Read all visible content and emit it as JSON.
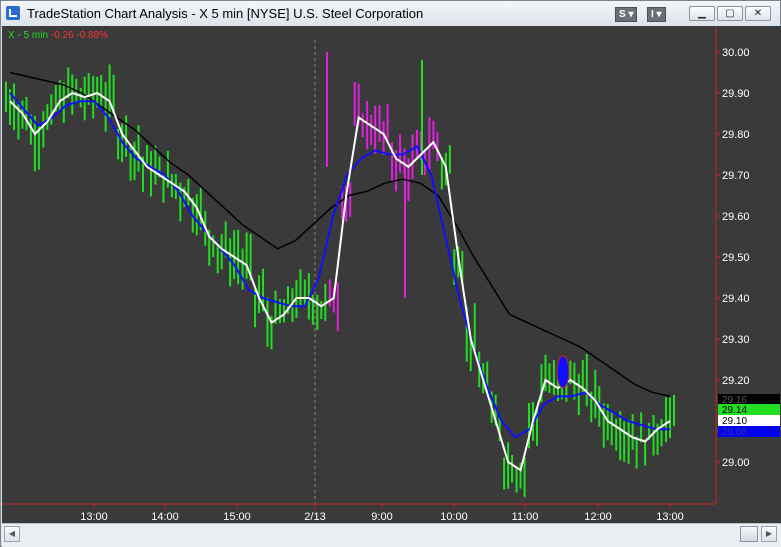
{
  "window": {
    "title": "TradeStation Chart Analysis - X 5 min [NYSE] U.S. Steel Corporation",
    "btn_s": "S ▾",
    "btn_i": "I ▾"
  },
  "chart_header": {
    "symbol": "X - 5 min",
    "change": "-0.26",
    "pct": "-0.88%"
  },
  "colors": {
    "background": "#3a3a3a",
    "up_bar": "#22dd22",
    "down_bar": "#22dd22",
    "highlight_bar": "#dd22dd",
    "fast_avg": "#ffffff",
    "mid_avg": "#1010ff",
    "slow_avg": "#000000",
    "axis": "#cc2222"
  },
  "price_labels": [
    {
      "text": "29.16",
      "bg": "#000000",
      "fg": "#555555"
    },
    {
      "text": "29.14",
      "bg": "#22dd22",
      "fg": "#000000"
    },
    {
      "text": "29.10",
      "bg": "#ffffff",
      "fg": "#000000"
    },
    {
      "text": "29.08",
      "bg": "#0000ee",
      "fg": "#3333aa"
    }
  ],
  "chart_data": {
    "type": "line",
    "ylim": [
      28.95,
      30.02
    ],
    "y_ticks": [
      "30.00",
      "29.90",
      "29.80",
      "29.70",
      "29.60",
      "29.50",
      "29.40",
      "29.30",
      "29.20",
      "29.10",
      "29.00"
    ],
    "y_tick_values": [
      30.0,
      29.9,
      29.8,
      29.7,
      29.6,
      29.5,
      29.4,
      29.3,
      29.2,
      29.1,
      29.0
    ],
    "x_ticks": [
      "13:00",
      "14:00",
      "15:00",
      "2/13",
      "9:00",
      "10:00",
      "11:00",
      "12:00",
      "13:00"
    ],
    "series": [
      {
        "values": [
          29.88,
          29.85,
          29.8,
          29.83,
          29.88,
          29.9,
          29.89,
          29.9,
          29.88,
          29.8,
          29.76,
          29.72,
          29.7,
          29.68,
          29.66,
          29.62,
          29.55,
          29.52,
          29.5,
          29.48,
          29.4,
          29.34,
          29.36,
          29.4,
          29.4,
          29.38,
          29.4,
          29.65,
          29.84,
          29.82,
          29.8,
          29.74,
          29.72,
          29.75,
          29.78,
          29.72,
          29.5,
          29.3,
          29.2,
          29.1,
          29.0,
          28.98,
          29.1,
          29.2,
          29.18,
          29.2,
          29.18,
          29.15,
          29.1,
          29.08,
          29.06,
          29.05,
          29.08,
          29.1
        ]
      },
      {
        "values": [
          29.9,
          29.86,
          29.82,
          29.84,
          29.87,
          29.88,
          29.88,
          29.84,
          29.78,
          29.74,
          29.72,
          29.7,
          29.66,
          29.6,
          29.56,
          29.52,
          29.48,
          29.42,
          29.4,
          29.39,
          29.38,
          29.38,
          29.45,
          29.6,
          29.7,
          29.74,
          29.76,
          29.75,
          29.75,
          29.77,
          29.7,
          29.55,
          29.4,
          29.28,
          29.18,
          29.1,
          29.06,
          29.08,
          29.14,
          29.16,
          29.16,
          29.17,
          29.14,
          29.12,
          29.1,
          29.09,
          29.08,
          29.08
        ]
      },
      {
        "values": [
          29.95,
          29.94,
          29.93,
          29.92,
          29.9,
          29.87,
          29.84,
          29.81,
          29.77,
          29.73,
          29.7,
          29.66,
          29.62,
          29.58,
          29.55,
          29.52,
          29.54,
          29.58,
          29.62,
          29.65,
          29.66,
          29.68,
          29.69,
          29.68,
          29.65,
          29.58,
          29.5,
          29.43,
          29.36,
          29.34,
          29.32,
          29.3,
          29.28,
          29.25,
          29.22,
          29.19,
          29.17,
          29.16
        ]
      }
    ]
  }
}
